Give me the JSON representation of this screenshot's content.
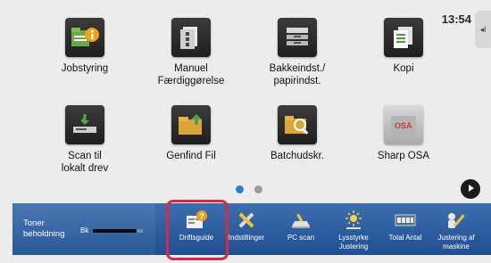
{
  "status": {
    "time": "13:54",
    "side_tab_icon": "collapse-arrow-icon"
  },
  "apps": [
    {
      "name": "jobstyring",
      "label": "Jobstyring",
      "icon": "job-status-icon"
    },
    {
      "name": "manuel-faerdiggoerelse",
      "label": "Manuel\nFærdiggørelse",
      "icon": "manual-finishing-icon"
    },
    {
      "name": "bakkeindst",
      "label": "Bakkeindst./\npapirindst.",
      "icon": "tray-settings-icon"
    },
    {
      "name": "kopi",
      "label": "Kopi",
      "icon": "copy-icon"
    },
    {
      "name": "scan-til-lokalt-drev",
      "label": "Scan til\nlokalt drev",
      "icon": "scan-to-local-drive-icon"
    },
    {
      "name": "genfind-fil",
      "label": "Genfind Fil",
      "icon": "retrieve-file-icon"
    },
    {
      "name": "batchudskr",
      "label": "Batchudskr.",
      "icon": "batch-print-icon"
    },
    {
      "name": "sharp-osa",
      "label": "Sharp OSA",
      "icon": "sharp-osa-icon"
    }
  ],
  "pager": {
    "pages": 2,
    "active": 0
  },
  "toner": {
    "label": "Toner\nbeholdning",
    "color_code": "Bk",
    "level_fraction": 0.88
  },
  "shortcuts": [
    {
      "name": "driftsguide",
      "label": "Driftsguide",
      "icon": "operation-guide-icon",
      "highlighted": true
    },
    {
      "name": "indstillinger",
      "label": "Indstillinger",
      "icon": "settings-tools-icon"
    },
    {
      "name": "pc-scan",
      "label": "PC scan",
      "icon": "pc-scan-icon"
    },
    {
      "name": "lysstyrke-justering",
      "label": "Lysstyrke\nJustering",
      "icon": "brightness-icon"
    },
    {
      "name": "total-antal",
      "label": "Total Antal",
      "icon": "total-count-icon"
    },
    {
      "name": "justering-af-maskine",
      "label": "Justering af\nmaskine",
      "icon": "machine-adjustment-icon"
    }
  ],
  "colors": {
    "bar_top": "#3d6fb0",
    "bar_bottom": "#1f4f92",
    "highlight": "#d42c45",
    "pager_active": "#2f7bd6"
  }
}
